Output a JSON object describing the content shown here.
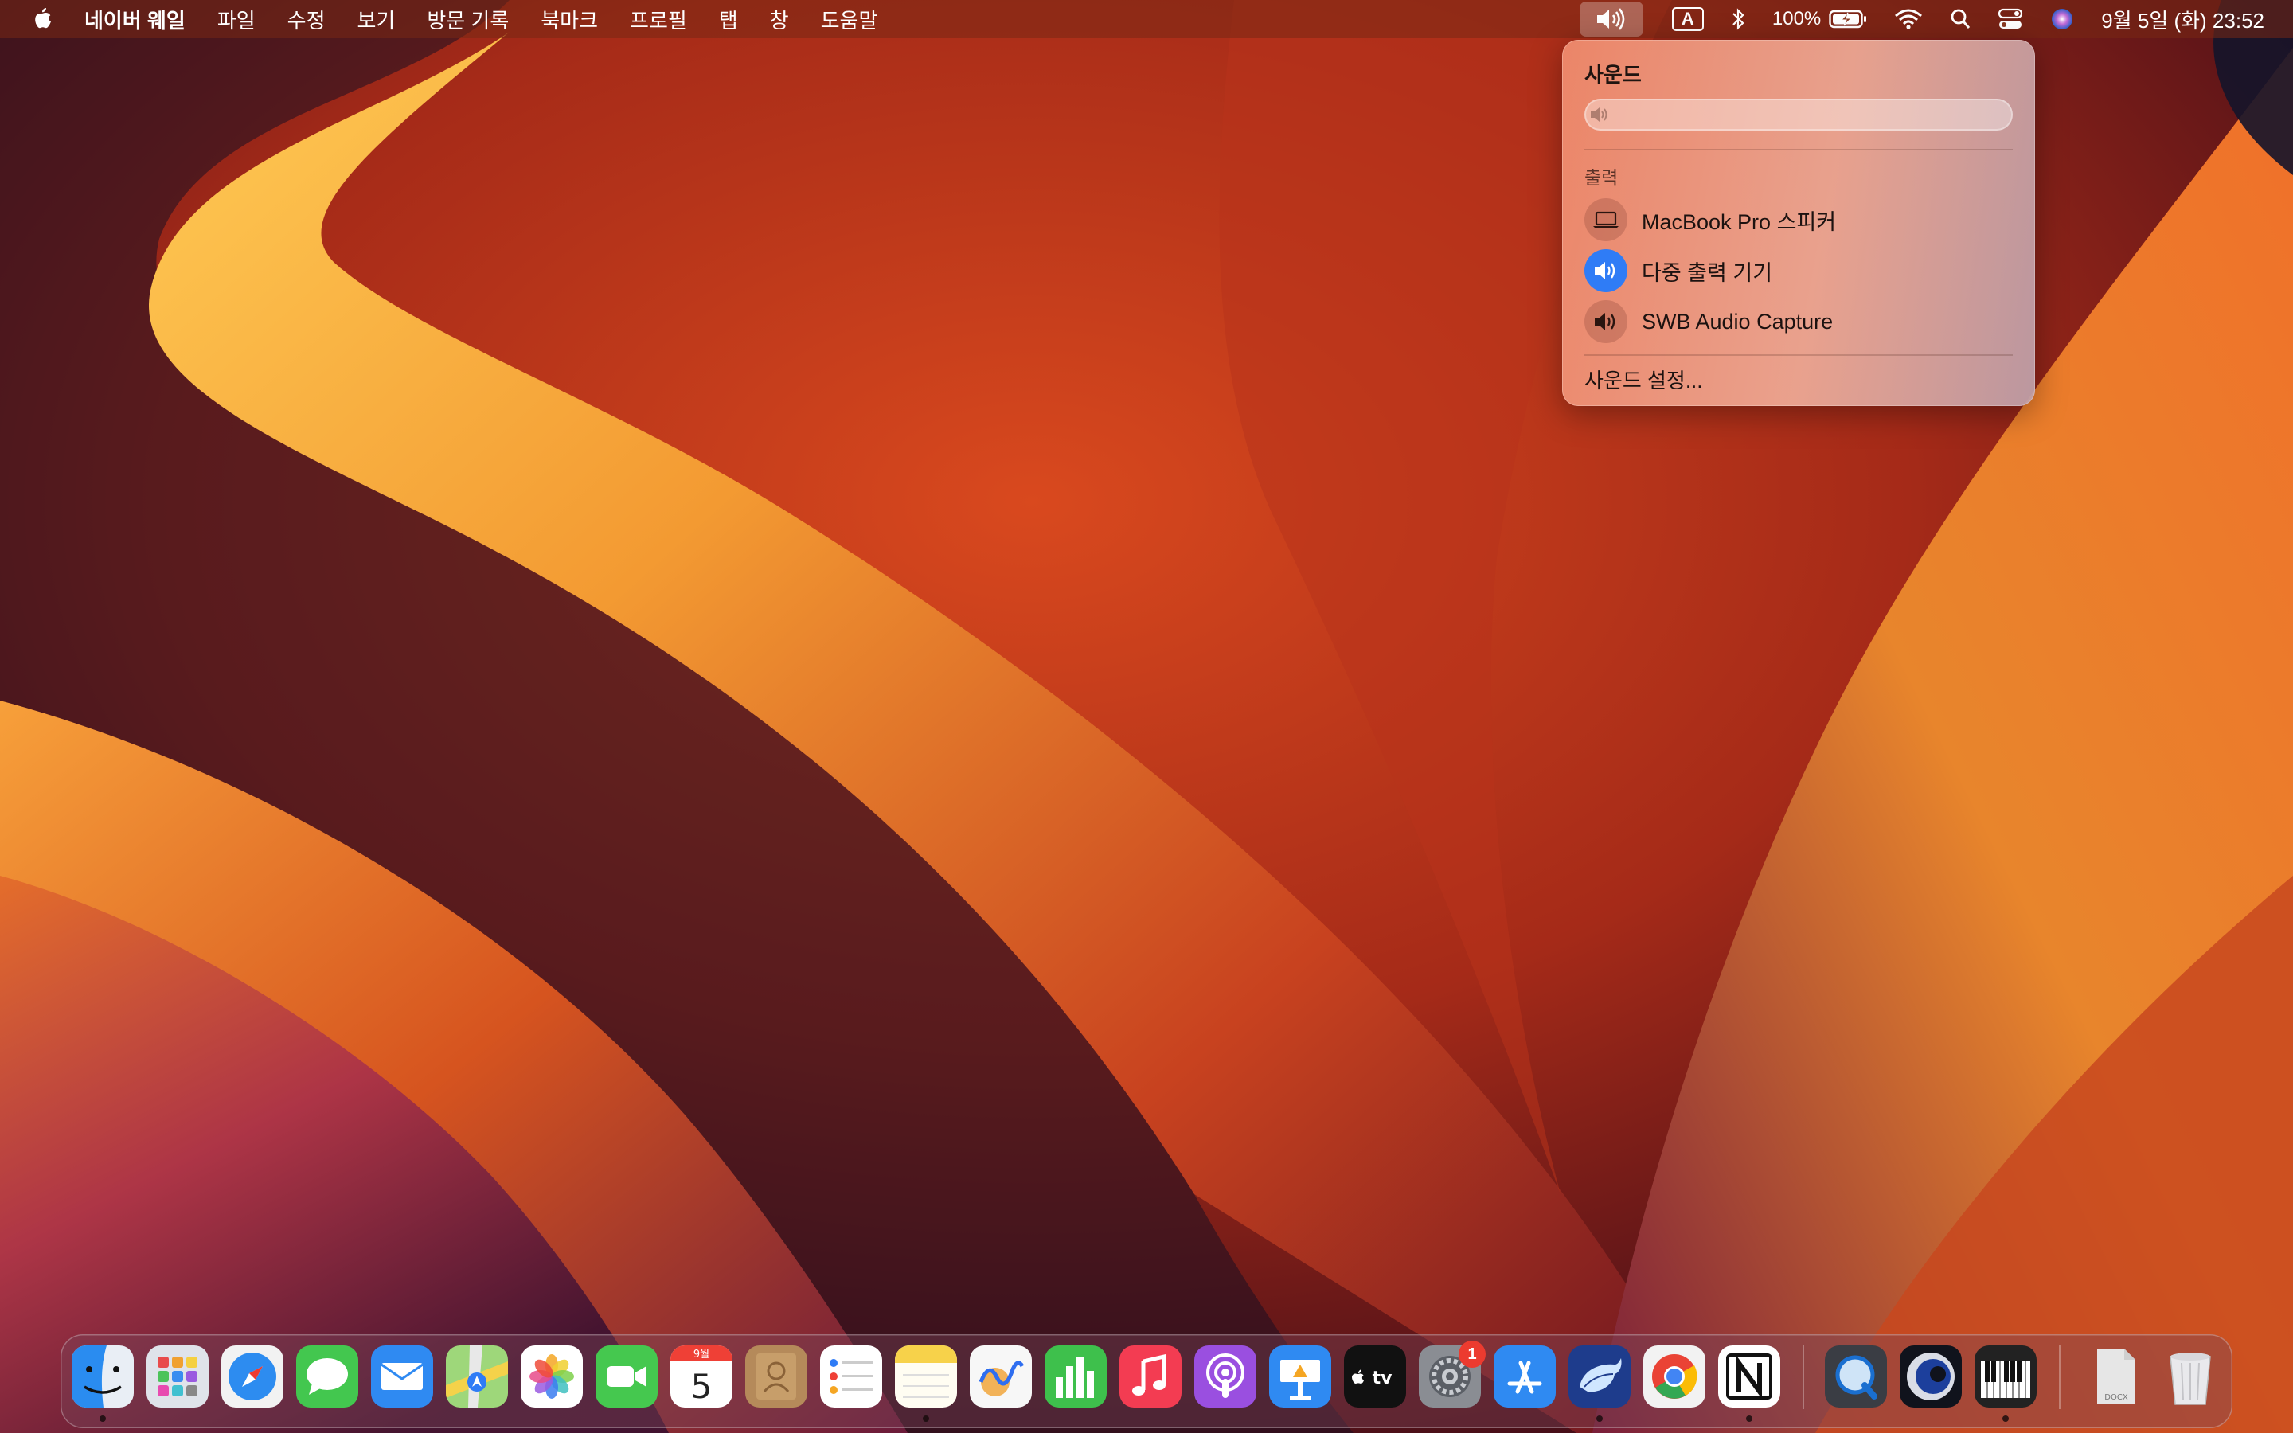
{
  "menubar": {
    "app_name": "네이버 웨일",
    "menus": [
      "파일",
      "수정",
      "보기",
      "방문 기록",
      "북마크",
      "프로필",
      "탭",
      "창",
      "도움말"
    ],
    "input_source": "A",
    "battery_percent": "100%",
    "datetime": "9월 5일 (화) 23:52",
    "status_icons": [
      "sound-icon",
      "input-source-icon",
      "bluetooth-icon",
      "battery-charging-icon",
      "wifi-icon",
      "spotlight-search-icon",
      "control-center-icon",
      "siri-icon"
    ]
  },
  "sound_menu": {
    "title": "사운드",
    "volume_level": 0.0,
    "output_label": "출력",
    "devices": [
      {
        "label": "MacBook Pro 스피커",
        "icon": "laptop-icon",
        "selected": false
      },
      {
        "label": "다중 출력 기기",
        "icon": "speaker-icon",
        "selected": true
      },
      {
        "label": "SWB Audio Capture",
        "icon": "speaker-icon",
        "selected": false
      }
    ],
    "settings_label": "사운드 설정..."
  },
  "dock": {
    "apps": [
      "Finder",
      "Launchpad",
      "Safari",
      "Messages",
      "Mail",
      "Maps",
      "Photos",
      "FaceTime",
      "Calendar",
      "Contacts",
      "Reminders",
      "Notes",
      "Freeform",
      "Numbers",
      "Music",
      "Podcasts",
      "Keynote",
      "TV",
      "System Settings",
      "App Store",
      "Whale",
      "Chrome",
      "Notion",
      "QuickTime Player",
      "Cinema 4D",
      "Piano",
      "Document",
      "Trash"
    ],
    "calendar_month": "9월",
    "calendar_day": "5",
    "system_settings_badge": "1",
    "tv_label": "tv",
    "doc_label": "DOCX"
  },
  "colors": {
    "selected_device_bg": "#2f7cf6",
    "badge": "#ec3b2f"
  }
}
